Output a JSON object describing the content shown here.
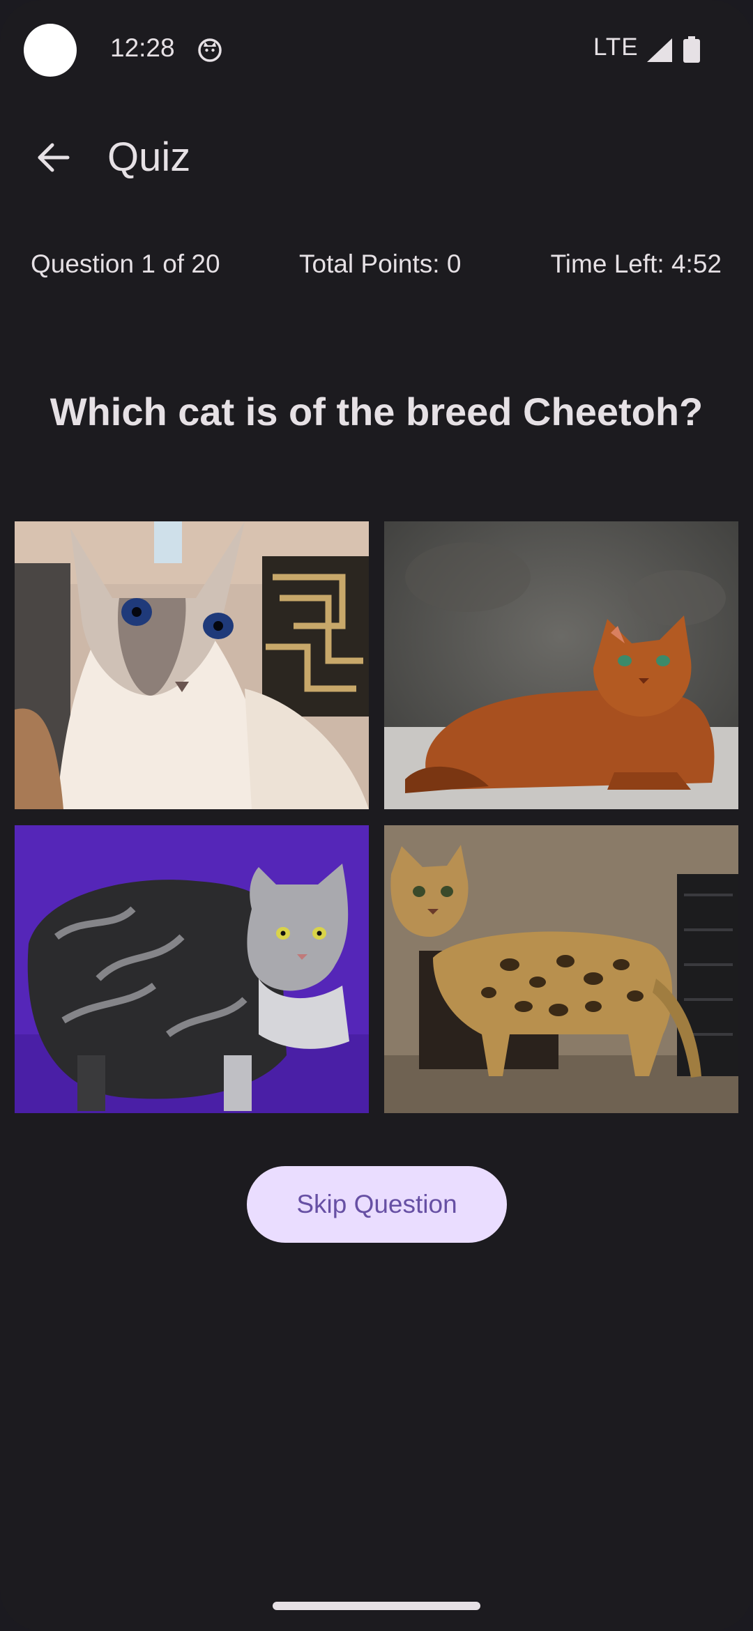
{
  "status_bar": {
    "time": "12:28",
    "network": "LTE",
    "icons": [
      "camera-dot",
      "cat-app-icon",
      "signal-icon",
      "battery-icon"
    ]
  },
  "app_bar": {
    "back_icon": "arrow-back-icon",
    "title": "Quiz"
  },
  "info": {
    "question_progress": "Question 1 of 20",
    "points": "Total Points: 0",
    "time_left": "Time Left: 4:52"
  },
  "question": {
    "text": "Which cat is of the breed Cheetoh?"
  },
  "answers": [
    {
      "image": "balinese-cat-blue-eyes"
    },
    {
      "image": "somali-cat-lying"
    },
    {
      "image": "silver-tabby-cat-purple-bg"
    },
    {
      "image": "bengal-cat-standing"
    }
  ],
  "skip": {
    "label": "Skip Question"
  },
  "colors": {
    "background": "#1c1b1f",
    "on_surface": "#e6e1e5",
    "button_bg": "#eaddff",
    "button_text": "#6750a4"
  }
}
